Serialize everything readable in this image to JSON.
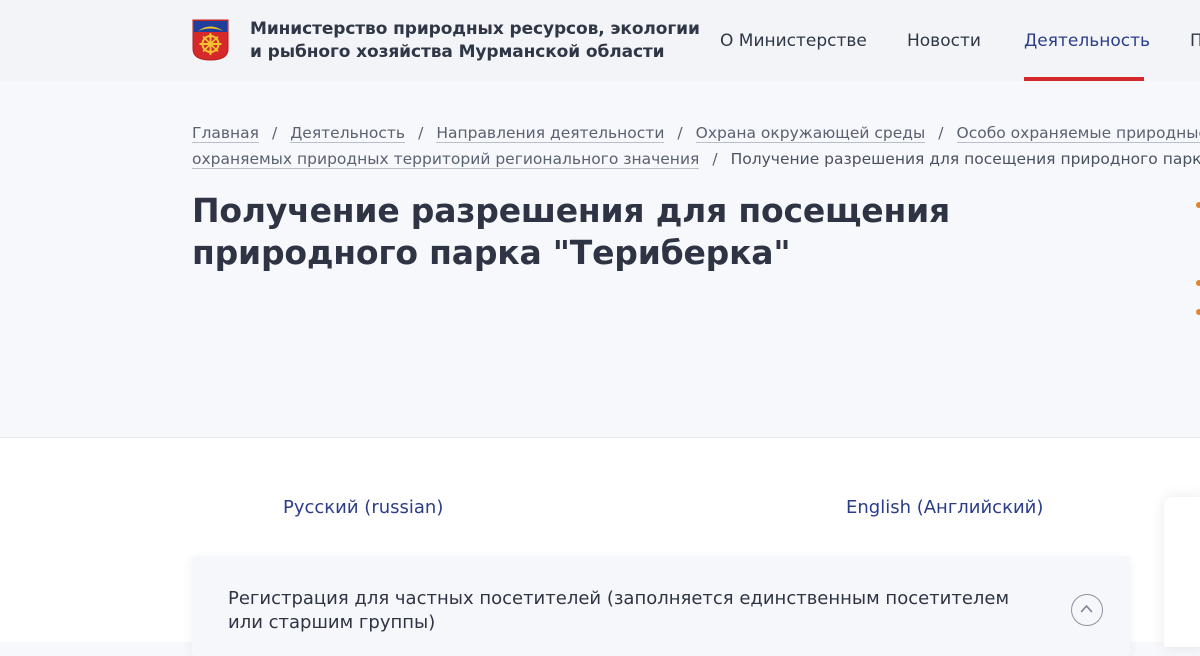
{
  "header": {
    "org_name": "Министерство природных ресурсов, экологии и рыбного хозяйства Мурманской области",
    "logo_icon": "murmansk-region-coat-of-arms-icon",
    "nav": [
      {
        "label": "О Министерстве",
        "active": false
      },
      {
        "label": "Новости",
        "active": false
      },
      {
        "label": "Деятельность",
        "active": true
      },
      {
        "label": "П",
        "active": false
      }
    ],
    "accent_color": "#d3272a"
  },
  "breadcrumbs": {
    "items": [
      "Главная",
      "Деятельность",
      "Направления деятельности",
      "Охрана окружающей среды",
      "Особо охраняемые природные те",
      "охраняемых природных территорий регионального значения"
    ],
    "current": "Получение разрешения для посещения природного парка \"Те"
  },
  "page": {
    "title": "Получение разрешения для посещения природного парка \"Териберка\""
  },
  "languages": {
    "russian": "Русский (russian)",
    "english": "English (Английский)"
  },
  "accordion": {
    "title": "Регистрация для частных посетителей (заполняется единственным посетителем или старшим группы)",
    "toggle_icon": "chevron-up-icon",
    "expanded": true
  }
}
